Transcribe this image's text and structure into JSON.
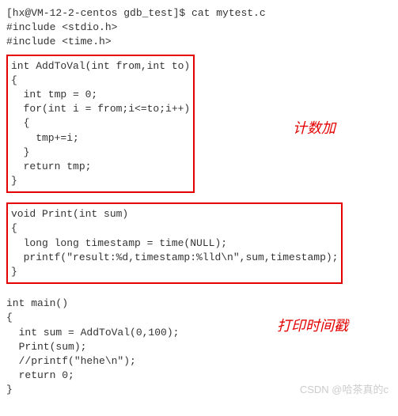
{
  "prompt": "[hx@VM-12-2-centos gdb_test]$ cat mytest.c",
  "includes": [
    "#include <stdio.h>",
    "#include <time.h>"
  ],
  "func1": {
    "lines": [
      "int AddToVal(int from,int to)",
      "{",
      "  int tmp = 0;",
      "  for(int i = from;i<=to;i++)",
      "  {",
      "    tmp+=i;",
      "  }",
      "  return tmp;",
      "}"
    ]
  },
  "func2": {
    "lines": [
      "void Print(int sum)",
      "{",
      "  long long timestamp = time(NULL);",
      "  printf(\"result:%d,timestamp:%lld\\n\",sum,timestamp);",
      "}"
    ]
  },
  "main": {
    "lines": [
      "int main()",
      "{",
      "  int sum = AddToVal(0,100);",
      "  Print(sum);",
      "  //printf(\"hehe\\n\");",
      "  return 0;",
      "}"
    ]
  },
  "annotations": {
    "a1": "计数加",
    "a2": "打印时间戳"
  },
  "watermark": "CSDN @哈茶真的c"
}
